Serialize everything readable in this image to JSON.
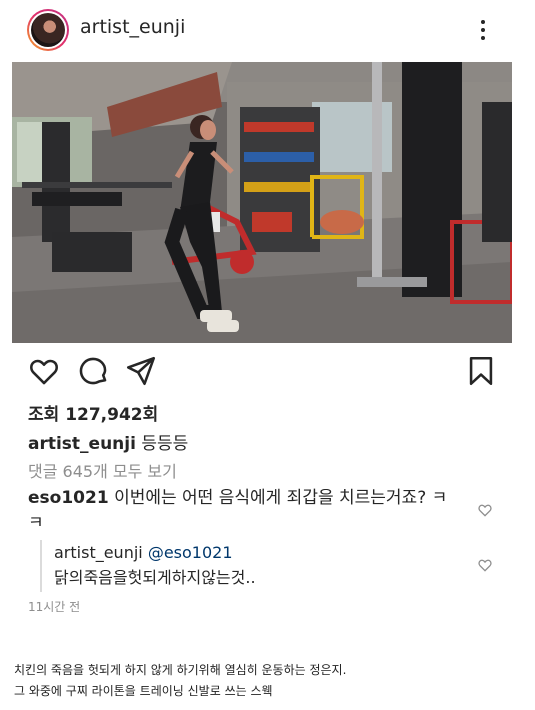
{
  "post": {
    "username": "artist_eunji",
    "views": "조회 127,942회",
    "caption_user": "artist_eunji",
    "caption_text": "등등등",
    "view_comments": "댓글 645개 모두 보기"
  },
  "comment": {
    "user": "eso1021",
    "text": "이번에는 어떤 음식에게 죄갑을 치르는거죠? ㅋㅋ"
  },
  "reply": {
    "user": "artist_eunji",
    "mention": "@eso1021",
    "text": "닭의죽음을헛되게하지않는것.."
  },
  "time": "11시간 전",
  "footer": {
    "line1": "치킨의 죽음을 헛되게 하지 않게 하기위해 열심히 운동하는 정은지.",
    "line2": "그 와중에 구찌 라이톤을 트레이닝 신발로 쓰는 스웩"
  },
  "icons": {
    "like": "heart-icon",
    "comment": "comment-icon",
    "share": "send-icon",
    "save": "bookmark-icon",
    "more": "more-icon"
  }
}
